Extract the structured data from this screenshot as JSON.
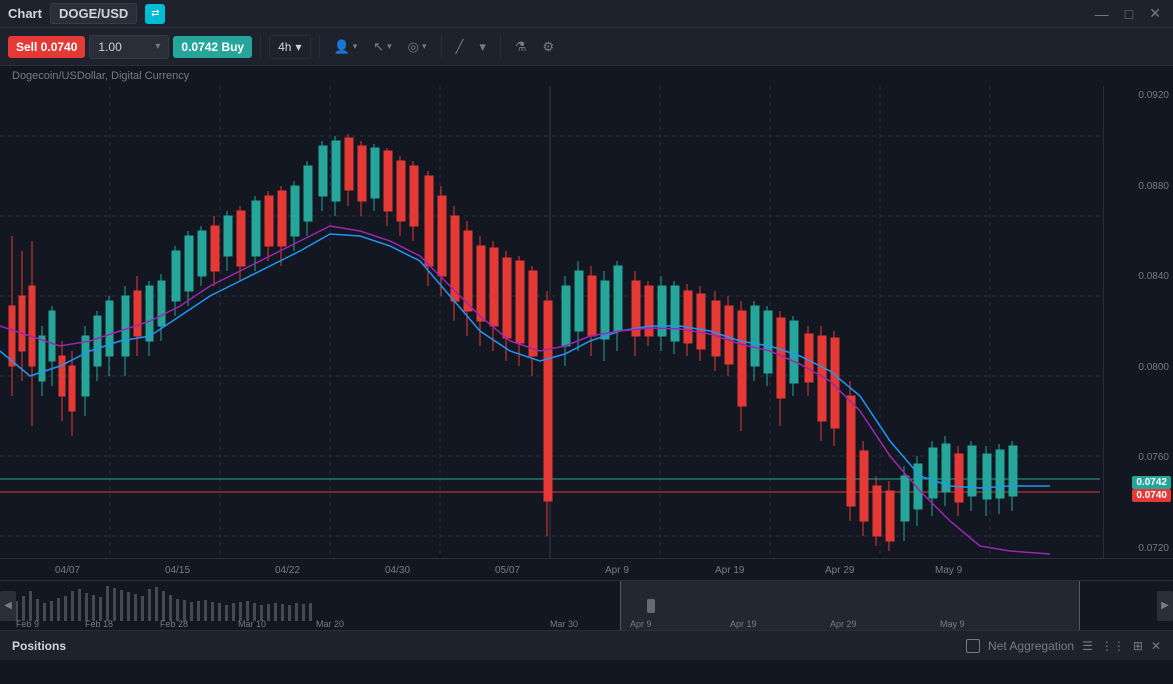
{
  "titlebar": {
    "title": "Chart",
    "symbol": "DOGE/USD",
    "connect_icon": "⇄",
    "min_icon": "—",
    "max_icon": "□",
    "close_icon": "×"
  },
  "toolbar": {
    "sell_label": "Sell 0.0740",
    "quantity": "1.00",
    "quantity_placeholder": "1.00",
    "buy_price": "0.0742",
    "buy_label": "Buy",
    "interval": "4h",
    "interval_arrow": "▾",
    "tools": [
      {
        "name": "people-icon",
        "label": "👤",
        "arrow": "▾"
      },
      {
        "name": "cursor-icon",
        "label": "↖",
        "arrow": "▾"
      },
      {
        "name": "indicator-icon",
        "label": "⊙",
        "arrow": "▾"
      },
      {
        "name": "line-tool-icon",
        "label": "╱"
      },
      {
        "name": "line-tool-arrow",
        "label": "▾"
      },
      {
        "name": "flask-icon",
        "label": "⚗"
      },
      {
        "name": "settings-icon",
        "label": "⚙"
      }
    ]
  },
  "subtitle": "Dogecoin/USDollar, Digital Currency",
  "chart": {
    "prices": {
      "high": "0.0920",
      "mid1": "0.0880",
      "mid2": "0.0840",
      "mid3": "0.0800",
      "mid4": "0.0760",
      "current_green": "0.0742",
      "current_red": "0.0740",
      "low": "0.0720"
    },
    "dates_top": [
      "04/07",
      "04/15",
      "04/22",
      "04/30",
      "05/07"
    ],
    "dates_bottom": [
      "Feb 9",
      "Feb 18",
      "Feb 28",
      "Mar 10",
      "Mar 20",
      "Mar 30",
      "Apr 9",
      "Apr 19",
      "Apr 29",
      "May 9"
    ]
  },
  "bottom_bar": {
    "positions_label": "Positions",
    "net_aggregation_label": "Net Aggregation"
  }
}
